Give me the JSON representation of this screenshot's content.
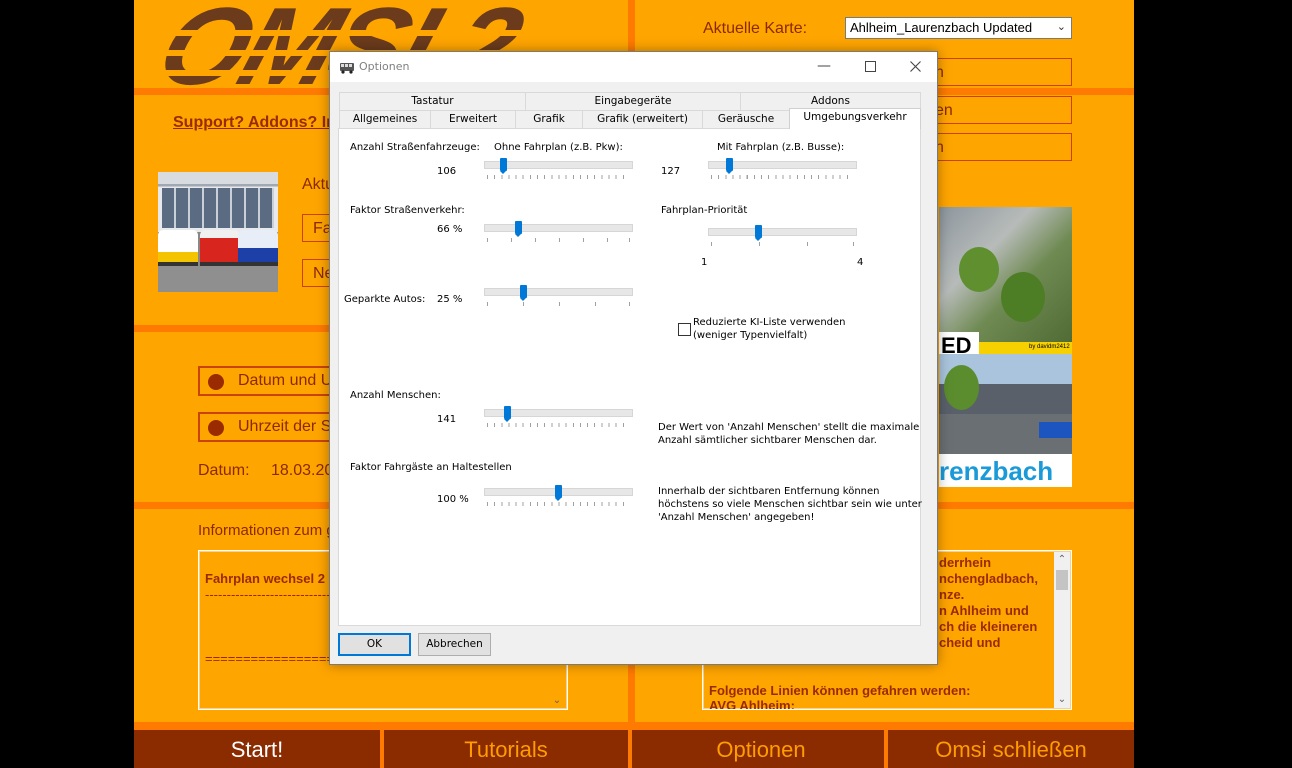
{
  "launcher": {
    "support_link": "Support? Addons? In",
    "current_map_label": "Aktuelle Karte:",
    "current_map_value": "Ahlheim_Laurenzbach Updated",
    "right_buttons": [
      "n",
      "en",
      "n"
    ],
    "aktu_label": "Aktu",
    "small_buttons": [
      "Fa",
      "Ne"
    ],
    "radio_date": "Datum und U",
    "radio_time": "Uhrzeit der S",
    "datum_label": "Datum:",
    "datum_value": "18.03.20",
    "info_label": "Informationen zum g",
    "left_textbox": {
      "line1": "Fahrplan wechsel 2",
      "line2": "------------------------------------------",
      "line3": "=========================="
    },
    "right_textbox": {
      "lines": [
        "derrhein",
        "nchengladbach,",
        "nze.",
        "n Ahlheim und",
        "ch die kleineren",
        "cheid und"
      ],
      "line_bottom1": "Folgende Linien können gefahren werden:",
      "line_bottom2": "AVG Ahlheim:"
    },
    "preview_caption1": "ED",
    "preview_caption2": "renzbach",
    "preview_credit": "by davidm2412",
    "bottom_buttons": [
      "Start!",
      "Tutorials",
      "Optionen",
      "Omsi schließen"
    ]
  },
  "dialog": {
    "title": "Optionen",
    "tabs_back": [
      "Tastatur",
      "Eingabegeräte",
      "Addons"
    ],
    "tabs_front": [
      "Allgemeines",
      "Erweitert",
      "Grafik",
      "Grafik (erweitert)",
      "Geräusche",
      "Umgebungsverkehr"
    ],
    "selected_tab": "Umgebungsverkehr",
    "vehicles_label": "Anzahl Straßenfahrzeuge:",
    "no_timetable_label": "Ohne Fahrplan (z.B. Pkw):",
    "no_timetable_value": "106",
    "no_timetable_level": 0.11,
    "timetable_label": "Mit Fahrplan (z.B. Busse):",
    "timetable_value": "127",
    "timetable_level": 0.13,
    "traffic_factor_label": "Faktor Straßenverkehr:",
    "traffic_factor_value": "66 %",
    "traffic_factor_level": 0.22,
    "priority_label": "Fahrplan-Priorität",
    "priority_min": "1",
    "priority_max": "4",
    "priority_level": 0.33,
    "parked_label": "Geparkte Autos:",
    "parked_value": "25 %",
    "parked_level": 0.25,
    "reduced_ai_line1": "Reduzierte KI-Liste verwenden",
    "reduced_ai_line2": "(weniger Typenvielfalt)",
    "reduced_ai_checked": false,
    "people_label": "Anzahl Menschen:",
    "people_value": "141",
    "people_level": 0.14,
    "people_info_line1": "Der Wert von 'Anzahl Menschen' stellt die maximale",
    "people_info_line2": "Anzahl sämtlicher sichtbarer Menschen dar.",
    "passengers_label": "Faktor Fahrgäste an Haltestellen",
    "passengers_value": "100 %",
    "passengers_level": 0.5,
    "passengers_info_line1": "Innerhalb der sichtbaren Entfernung können",
    "passengers_info_line2": "höchstens so viele Menschen sichtbar sein wie unter",
    "passengers_info_line3": "'Anzahl Menschen' angegeben!",
    "ok_label": "OK",
    "cancel_label": "Abbrechen"
  }
}
